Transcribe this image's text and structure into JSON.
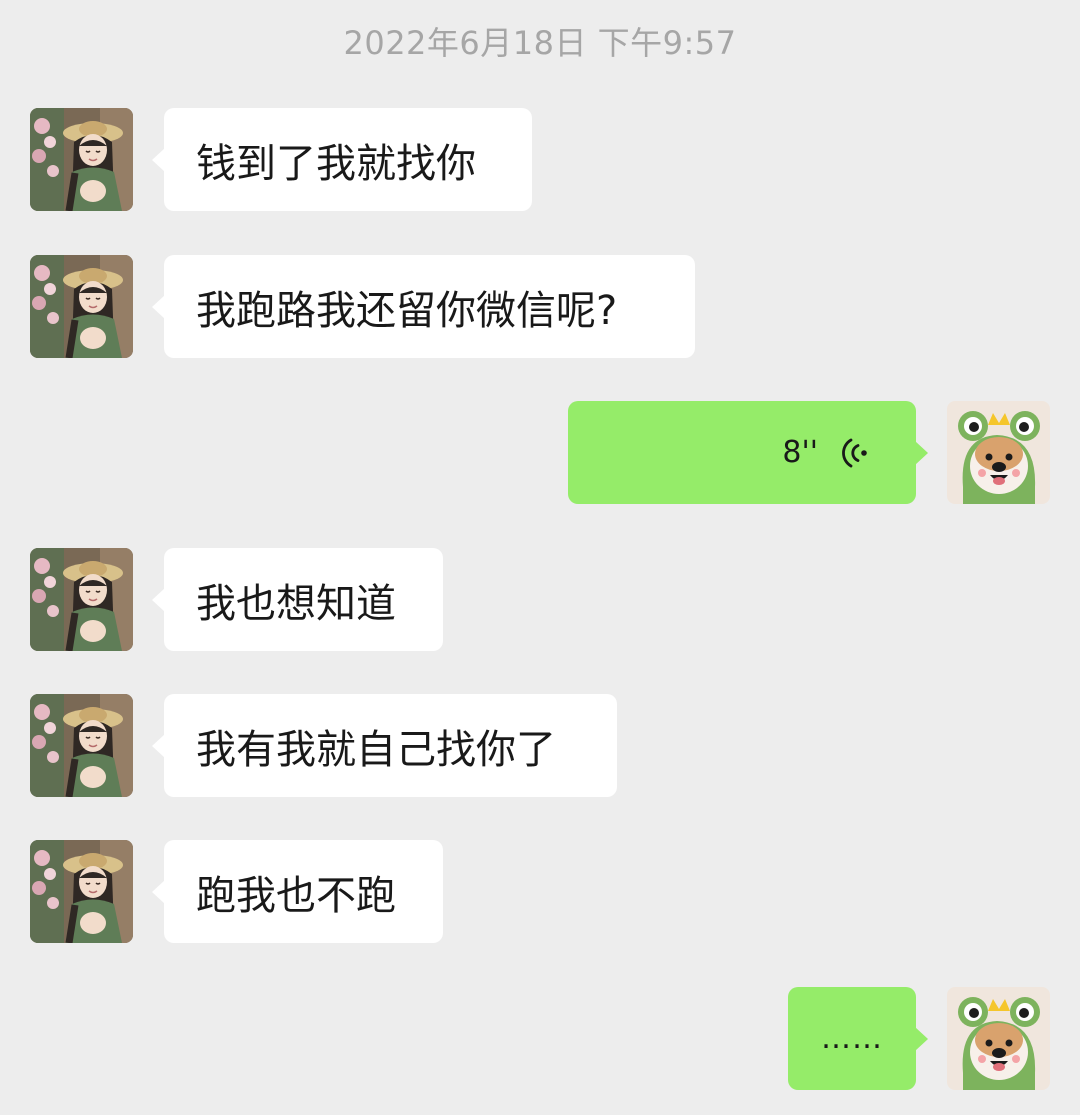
{
  "chat": {
    "timestamp": "2022年6月18日 下午9:57",
    "messages": [
      {
        "sender": "other",
        "type": "text",
        "text": "钱到了我就找你"
      },
      {
        "sender": "other",
        "type": "text",
        "text": "我跑路我还留你微信呢?"
      },
      {
        "sender": "self",
        "type": "voice",
        "duration": "8''",
        "icon": "voice-wave-icon"
      },
      {
        "sender": "other",
        "type": "text",
        "text": "我也想知道"
      },
      {
        "sender": "other",
        "type": "text",
        "text": "我有我就自己找你了"
      },
      {
        "sender": "other",
        "type": "text",
        "text": "跑我也不跑"
      },
      {
        "sender": "self",
        "type": "text",
        "text": "……"
      }
    ]
  },
  "colors": {
    "background": "#ededed",
    "incoming_bubble": "#ffffff",
    "outgoing_bubble": "#95ec69",
    "timestamp_text": "#a6a6a6",
    "message_text": "#191919"
  },
  "icons": {
    "other_avatar": "girl-avatar",
    "self_avatar": "frog-hat-dog-avatar",
    "voice": "voice-wave-icon"
  }
}
